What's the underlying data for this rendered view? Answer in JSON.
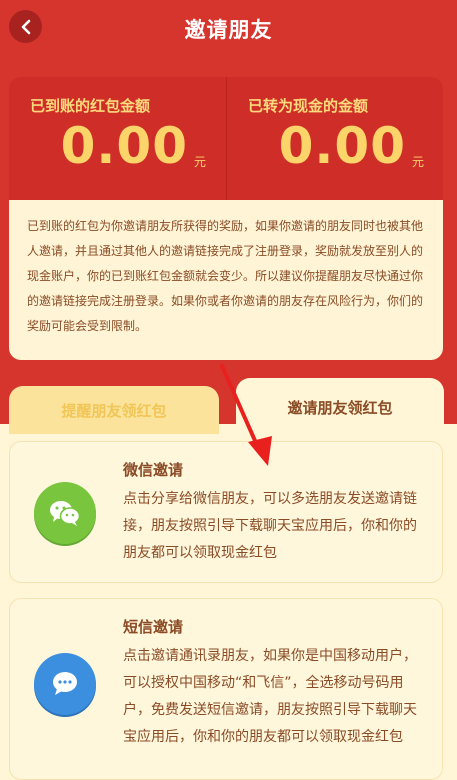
{
  "header": {
    "title": "邀请朋友"
  },
  "summary": {
    "received_label": "已到账的红包金额",
    "received_value": "0.00",
    "received_unit": "元",
    "cash_label": "已转为现金的金额",
    "cash_value": "0.00",
    "cash_unit": "元"
  },
  "notice": {
    "text": "已到账的红包为你邀请朋友所获得的奖励，如果你邀请的朋友同时也被其他人邀请，并且通过其他人的邀请链接完成了注册登录，奖励就发放至别人的现金账户，你的已到账红包金额就会变少。所以建议你提醒朋友尽快通过你的邀请链接完成注册登录。如果你或者你邀请的朋友存在风险行为，你们的奖励可能会受到限制。"
  },
  "tabs": [
    {
      "label": "提醒朋友领红包"
    },
    {
      "label": "邀请朋友领红包"
    }
  ],
  "cards": [
    {
      "title": "微信邀请",
      "desc": "点击分享给微信朋友，可以多选朋友发送邀请链接，朋友按照引导下载聊天宝应用后，你和你的朋友都可以领取现金红包",
      "icon": "wechat-icon"
    },
    {
      "title": "短信邀请",
      "desc": "点击邀请通讯录朋友，如果你是中国移动用户，可以授权中国移动“和飞信”，全选移动号码用户，免费发送短信邀请，朋友按照引导下载聊天宝应用后，你和你的朋友都可以领取现金红包",
      "icon": "message-icon"
    }
  ],
  "colors": {
    "brand_red": "#d6352e",
    "gold": "#fbd56a",
    "cream": "#fff6d7",
    "text_brown": "#8a4b25",
    "wechat_green": "#79c63e",
    "sms_blue": "#3b8fde"
  }
}
